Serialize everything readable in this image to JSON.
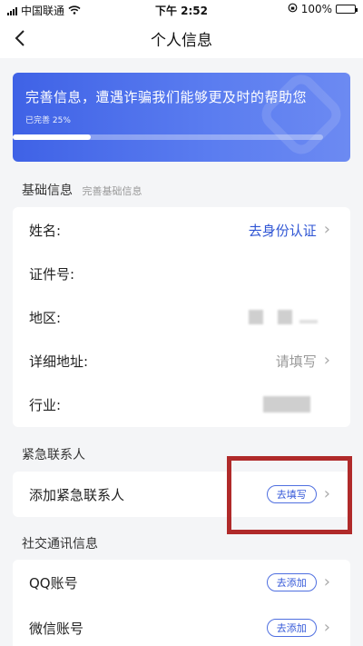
{
  "status_bar": {
    "carrier": "中国联通",
    "time": "下午 2:52",
    "battery_percent": "100%"
  },
  "nav": {
    "title": "个人信息"
  },
  "banner": {
    "title": "完善信息，遭遇诈骗我们能够更及时的帮助您",
    "progress_text": "已完善 25%",
    "progress_value": 0.25
  },
  "basic_info": {
    "title": "基础信息",
    "subtitle": "完善基础信息",
    "rows": [
      {
        "label": "姓名:",
        "value": "去身份认证"
      },
      {
        "label": "证件号:",
        "value": ""
      },
      {
        "label": "地区:",
        "value": ""
      },
      {
        "label": "详细地址:",
        "value": "请填写"
      },
      {
        "label": "行业:",
        "value": ""
      }
    ]
  },
  "emergency": {
    "title": "紧急联系人",
    "row_label": "添加紧急联系人",
    "button_label": "去填写"
  },
  "social": {
    "title": "社交通讯信息",
    "rows": [
      {
        "label": "QQ账号",
        "button_label": "去添加"
      },
      {
        "label": "微信账号",
        "button_label": "去添加"
      }
    ]
  },
  "colors": {
    "accent": "#3458d8",
    "banner_start": "#3f62e6",
    "highlight_box": "#b02a2a"
  }
}
